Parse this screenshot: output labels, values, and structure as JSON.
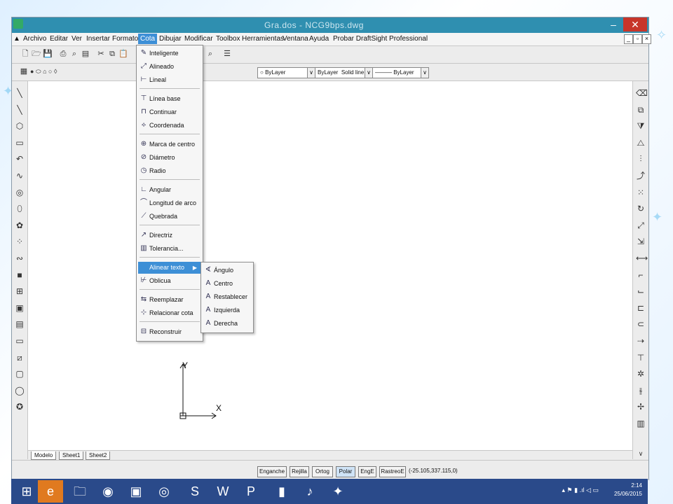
{
  "window": {
    "title": "Gra.dos - NCG9bps.dwg",
    "minimize_icon": "minimize-icon",
    "close_icon": "close-icon"
  },
  "menubar": {
    "items": [
      "Archivo",
      "Editar",
      "Ver",
      "Insertar",
      "Formato",
      "Cota",
      "Dibujar",
      "Modificar",
      "Toolbox",
      "Herramientas",
      "Ventana",
      "Ayuda",
      "Probar DraftSight Professional"
    ],
    "active_index": 5
  },
  "layer_bar": {
    "color_combo": "ByLayer",
    "linetype_combo": "ByLayer",
    "lineweight_combo": "Solid line",
    "lineweight2_combo": "——— ByLayer"
  },
  "cota_menu": {
    "items": [
      {
        "label": "Inteligente",
        "icon": "smart-dimension-icon"
      },
      {
        "label": "Alineado",
        "icon": "aligned-dimension-icon"
      },
      {
        "label": "Lineal",
        "icon": "linear-dimension-icon"
      },
      {
        "label": "Línea base",
        "icon": "baseline-dimension-icon"
      },
      {
        "label": "Continuar",
        "icon": "continue-dimension-icon"
      },
      {
        "label": "Coordenada",
        "icon": "ordinate-dimension-icon"
      },
      {
        "label": "Marca de centro",
        "icon": "center-mark-icon"
      },
      {
        "label": "Diámetro",
        "icon": "diameter-icon"
      },
      {
        "label": "Radio",
        "icon": "radius-icon"
      },
      {
        "label": "Angular",
        "icon": "angular-icon"
      },
      {
        "label": "Longitud de arco",
        "icon": "arc-length-icon"
      },
      {
        "label": "Quebrada",
        "icon": "jogged-icon"
      },
      {
        "label": "Directriz",
        "icon": "leader-icon"
      },
      {
        "label": "Tolerancia...",
        "icon": "tolerance-icon"
      },
      {
        "label": "Alinear texto",
        "icon": "",
        "highlighted": true
      },
      {
        "label": "Oblicua",
        "icon": "oblique-icon"
      },
      {
        "label": "Reemplazar",
        "icon": "override-icon"
      },
      {
        "label": "Relacionar cota",
        "icon": "reassociate-icon"
      },
      {
        "label": "Reconstruir",
        "icon": "rebuild-icon"
      }
    ]
  },
  "submenu": {
    "items": [
      "Ángulo",
      "Centro",
      "Restablecer",
      "Izquierda",
      "Derecha"
    ]
  },
  "axes": {
    "y_label": "Y",
    "x_label": "X"
  },
  "tabs": [
    "Modelo",
    "Sheet1",
    "Sheet2"
  ],
  "status": {
    "buttons": [
      {
        "label": "Enganche",
        "on": false
      },
      {
        "label": "Rejilla",
        "on": false
      },
      {
        "label": "Ortog",
        "on": false
      },
      {
        "label": "Polar",
        "on": true
      },
      {
        "label": "EngE",
        "on": false
      },
      {
        "label": "RastreoE",
        "on": false
      }
    ],
    "coordinates": "(-25.105,337.115,0)"
  },
  "taskbar": {
    "time": "2:14",
    "date": "25/06/2015"
  }
}
